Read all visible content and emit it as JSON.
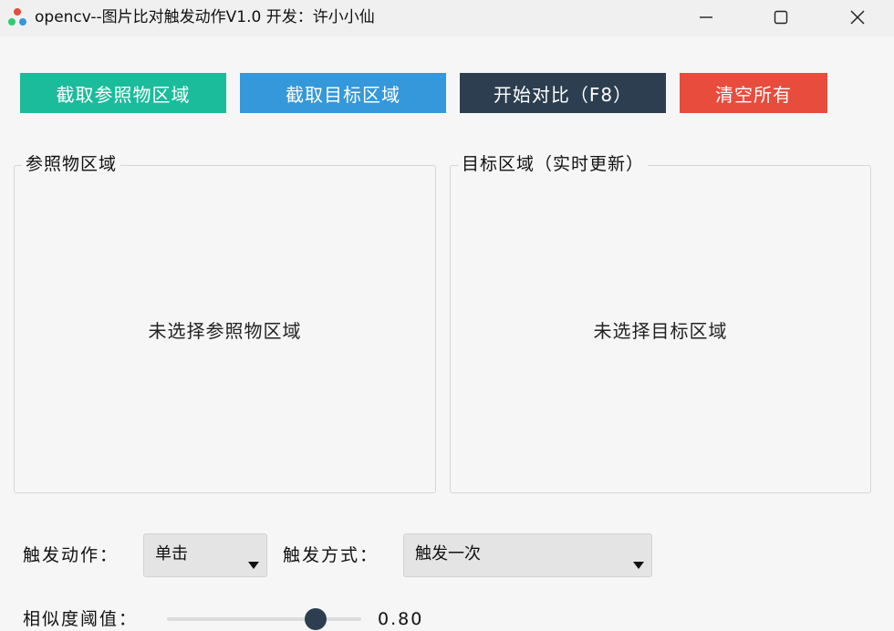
{
  "window": {
    "title": "opencv--图片比对触发动作V1.0  开发：许小小仙",
    "icon": "opencv-logo-icon"
  },
  "toolbar": {
    "ref_button": {
      "label": "截取参照物区域",
      "color": "#1abc9c"
    },
    "target_button": {
      "label": "截取目标区域",
      "color": "#3498db"
    },
    "start_button": {
      "label": "开始对比（F8）",
      "color": "#2c3e50"
    },
    "clear_button": {
      "label": "清空所有",
      "color": "#e74c3c"
    }
  },
  "panels": {
    "reference": {
      "title": "参照物区域",
      "placeholder": "未选择参照物区域"
    },
    "target": {
      "title": "目标区域（实时更新）",
      "placeholder": "未选择目标区域"
    }
  },
  "controls": {
    "trigger_action": {
      "label": "触发动作：",
      "value": "单击"
    },
    "trigger_mode": {
      "label": "触发方式：",
      "value": "触发一次"
    },
    "threshold": {
      "label": "相似度阈值：",
      "value": 0.8,
      "display": "0.80",
      "min": 0,
      "max": 1
    }
  }
}
